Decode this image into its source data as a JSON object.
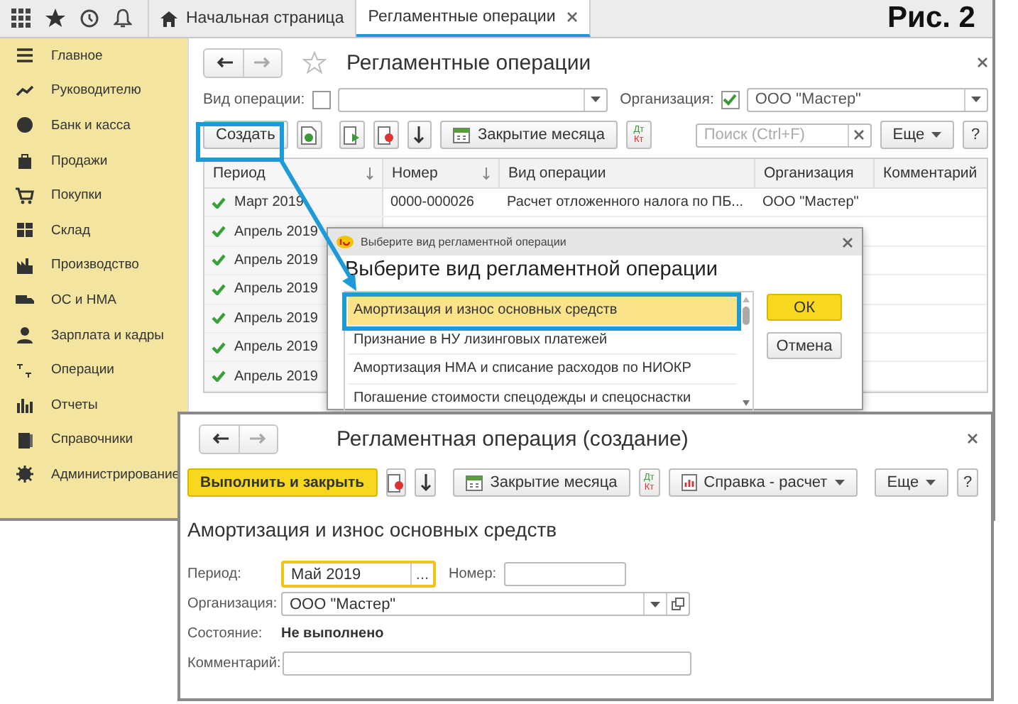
{
  "top_bar": {
    "tabs": [
      {
        "label": "Начальная страница",
        "selected": false
      },
      {
        "label": "Регламентные операции",
        "selected": true
      }
    ]
  },
  "figure_label": "Рис. 2",
  "sidebar": {
    "items": [
      {
        "label": "Главное"
      },
      {
        "label": "Руководителю"
      },
      {
        "label": "Банк и касса"
      },
      {
        "label": "Продажи"
      },
      {
        "label": "Покупки"
      },
      {
        "label": "Склад"
      },
      {
        "label": "Производство"
      },
      {
        "label": "ОС и НМА"
      },
      {
        "label": "Зарплата и кадры"
      },
      {
        "label": "Операции"
      },
      {
        "label": "Отчеты"
      },
      {
        "label": "Справочники"
      },
      {
        "label": "Администрирование"
      }
    ]
  },
  "list_form": {
    "title": "Регламентные операции",
    "filter": {
      "operation_label": "Вид операции:",
      "operation_checked": false,
      "organization_label": "Организация:",
      "organization_checked": true,
      "organization_value": "ООО \"Мастер\""
    },
    "toolbar": {
      "create": "Создать",
      "month_close": "Закрытие месяца",
      "dt": "Дт",
      "kt": "Кт",
      "search_placeholder": "Поиск (Ctrl+F)",
      "more": "Еще",
      "help": "?"
    },
    "columns": [
      {
        "label": "Период",
        "sort": true
      },
      {
        "label": "Номер",
        "sort": true
      },
      {
        "label": "Вид операции",
        "sort": false
      },
      {
        "label": "Организация",
        "sort": false
      },
      {
        "label": "Комментарий",
        "sort": false
      }
    ],
    "rows": [
      {
        "posted": true,
        "period": "Март 2019",
        "number": "0000-000026",
        "operation": "Расчет отложенного налога по ПБ...",
        "organization": "ООО \"Мастер\""
      },
      {
        "posted": true,
        "period": "Апрель 2019"
      },
      {
        "posted": true,
        "period": "Апрель 2019"
      },
      {
        "posted": true,
        "period": "Апрель 2019"
      },
      {
        "posted": true,
        "period": "Апрель 2019"
      },
      {
        "posted": true,
        "period": "Апрель 2019"
      },
      {
        "posted": true,
        "period": "Апрель 2019"
      }
    ]
  },
  "choice_dialog": {
    "window_title": "Выберите вид регламентной операции",
    "heading": "Выберите вид регламентной операции",
    "items": [
      {
        "label": "Амортизация и износ основных средств",
        "selected": true
      },
      {
        "label": "Признание в НУ лизинговых платежей",
        "selected": false
      },
      {
        "label": "Амортизация НМА и списание расходов по НИОКР",
        "selected": false
      },
      {
        "label": "Погашение стоимости спецодежды и спецоснастки",
        "selected": false
      }
    ],
    "ok": "ОК",
    "cancel": "Отмена"
  },
  "create_form": {
    "title": "Регламентная операция (создание)",
    "toolbar": {
      "run_close": "Выполнить и закрыть",
      "month_close": "Закрытие месяца",
      "dt": "Дт",
      "kt": "Кт",
      "report": "Справка - расчет",
      "more": "Еще",
      "help": "?"
    },
    "heading": "Амортизация и износ основных средств",
    "period_label": "Период:",
    "period_value": "Май 2019",
    "period_button": "...",
    "number_label": "Номер:",
    "organization_label": "Организация:",
    "organization_value": "ООО \"Мастер\"",
    "state_label": "Состояние:",
    "state_value": "Не выполнено",
    "comment_label": "Комментарий:"
  }
}
